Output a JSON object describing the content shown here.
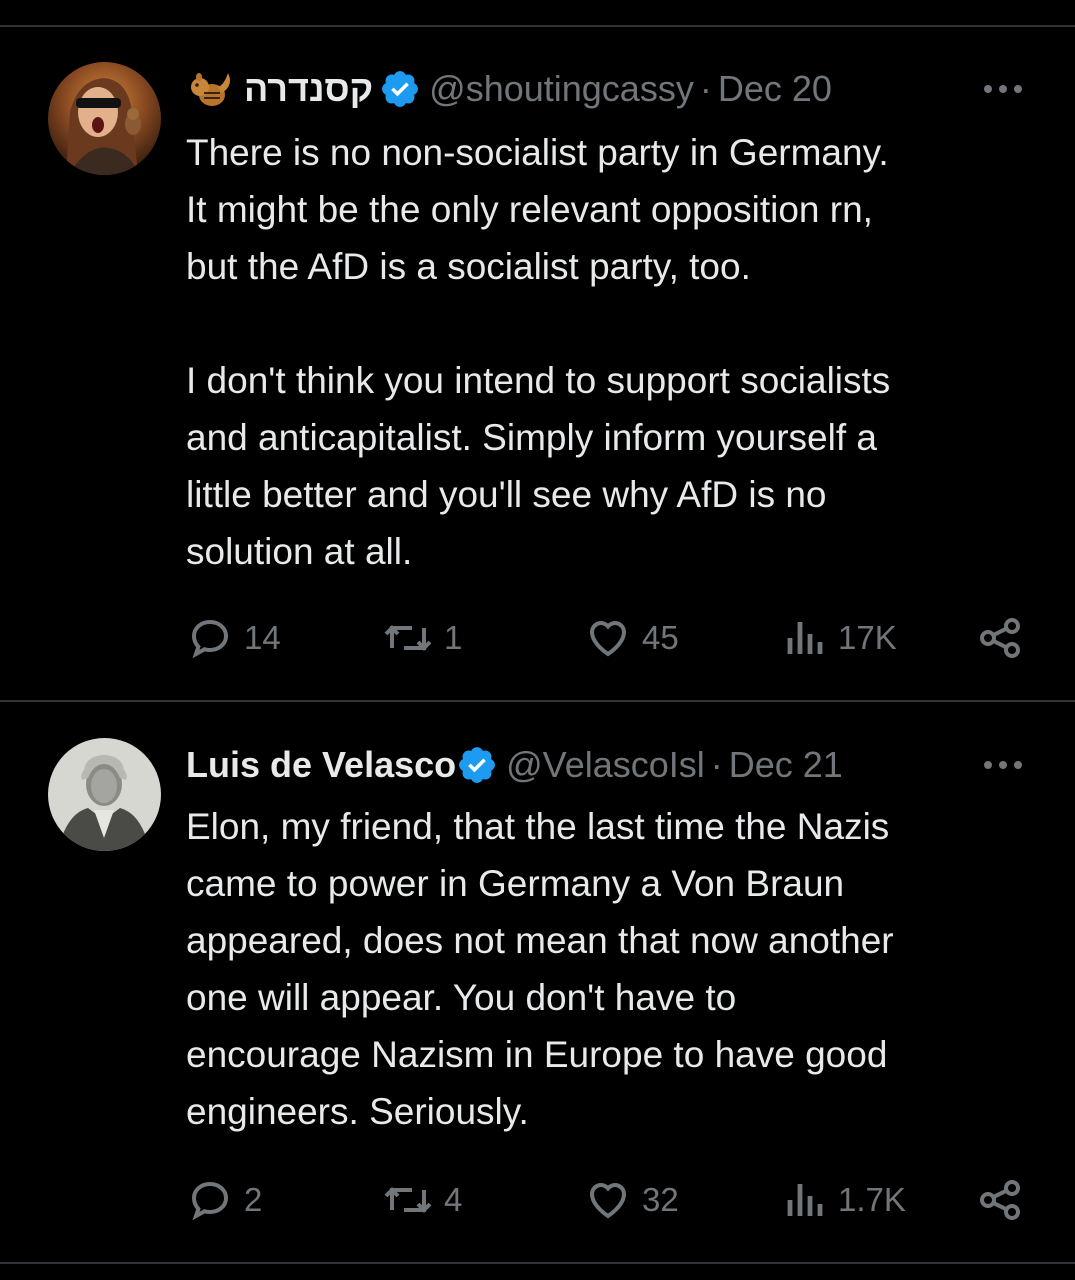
{
  "colors": {
    "background": "#000000",
    "text": "#e7e9ea",
    "muted": "#71767b",
    "verified": "#1d9bf0",
    "divider": "#2f3336"
  },
  "tweets": [
    {
      "display_name": "קסנדרה",
      "name_emoji": "chipmunk",
      "verified": true,
      "handle": "@shoutingcassy",
      "separator": "·",
      "date": "Dec 20",
      "lines": [
        "There is no non-socialist party in Germany.",
        "It might be the only relevant opposition rn,",
        "but the AfD is a socialist party, too.",
        "",
        "I don't think you intend to support socialists",
        "and anticapitalist. Simply inform yourself a",
        "little better and you'll see why AfD is no",
        "solution at all."
      ],
      "stats": {
        "replies": "14",
        "reposts": "1",
        "likes": "45",
        "views": "17K"
      }
    },
    {
      "display_name": "Luis de Velasco",
      "verified": true,
      "handle": "@VelascoIsl",
      "separator": "·",
      "date": "Dec 21",
      "lines": [
        "Elon, my friend, that the last time the Nazis",
        "came to power in Germany a Von Braun",
        "appeared, does not mean that now another",
        "one will appear. You don't have to",
        "encourage Nazism in Europe to have good",
        "engineers. Seriously."
      ],
      "stats": {
        "replies": "2",
        "reposts": "4",
        "likes": "32",
        "views": "1.7K"
      }
    }
  ],
  "icons": [
    "reply-icon",
    "repost-icon",
    "like-icon",
    "views-icon",
    "share-icon",
    "more-icon",
    "verified-badge-icon"
  ]
}
